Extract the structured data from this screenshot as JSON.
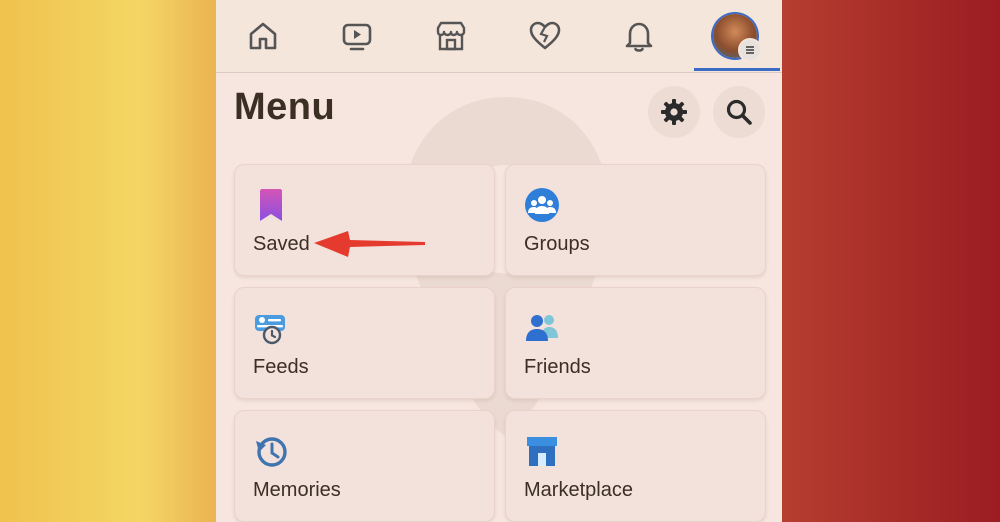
{
  "nav_tabs": [
    {
      "name": "home"
    },
    {
      "name": "video"
    },
    {
      "name": "marketplace"
    },
    {
      "name": "dating"
    },
    {
      "name": "notifications"
    },
    {
      "name": "profile-menu",
      "active": true
    }
  ],
  "menu": {
    "title": "Menu",
    "settings_icon": "gear-icon",
    "search_icon": "search-icon"
  },
  "shortcuts": [
    {
      "label": "Saved",
      "icon": "bookmark-icon"
    },
    {
      "label": "Groups",
      "icon": "groups-icon"
    },
    {
      "label": "Feeds",
      "icon": "feeds-icon"
    },
    {
      "label": "Friends",
      "icon": "friends-icon"
    },
    {
      "label": "Memories",
      "icon": "memories-icon"
    },
    {
      "label": "Marketplace",
      "icon": "marketplace-icon"
    }
  ],
  "colors": {
    "accent": "#3c6bc6",
    "annotation_arrow": "#e53b2f"
  }
}
